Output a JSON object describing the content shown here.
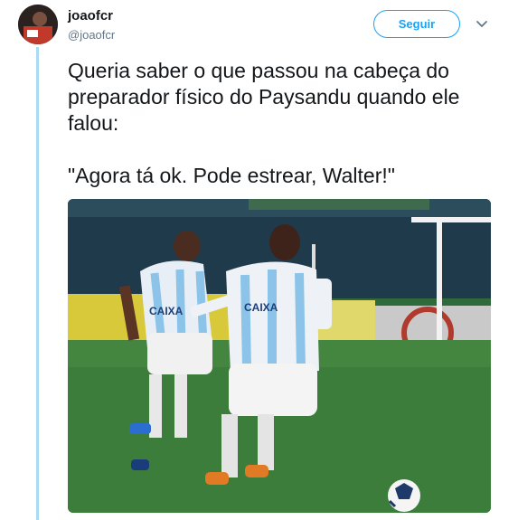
{
  "tweet": {
    "display_name": "joaofcr",
    "handle": "@joaofcr",
    "follow_label": "Seguir",
    "text_line1": "Queria saber o que passou na cabeça do preparador físico do Paysandu quando ele falou:",
    "text_line2": "\"Agora tá ok. Pode estrear, Walter!\""
  },
  "photo": {
    "shirt_sponsor": "CAIXA"
  },
  "icons": {
    "more": "chevron-down-icon"
  },
  "colors": {
    "accent": "#1da1f2",
    "thread_line": "#a9dcf4",
    "text": "#14171a",
    "muted": "#657786"
  }
}
